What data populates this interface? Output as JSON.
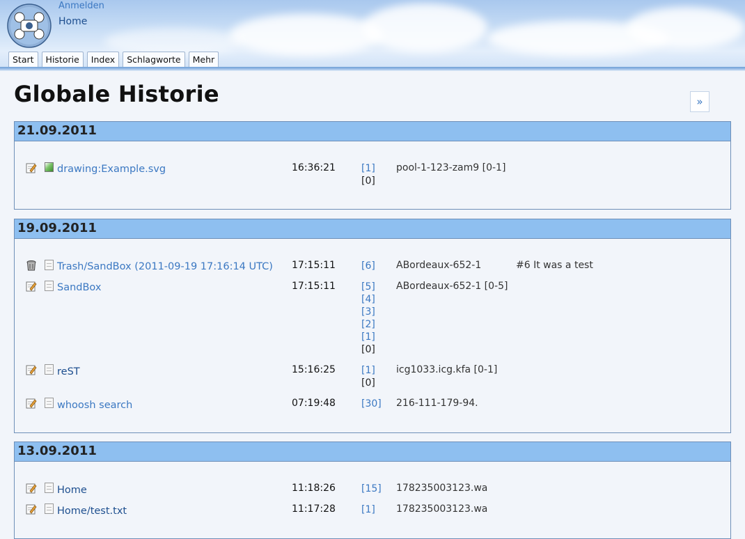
{
  "header": {
    "login_label": "Anmelden",
    "home_label": "Home",
    "tabs": [
      {
        "label": "Start"
      },
      {
        "label": "Historie"
      },
      {
        "label": "Index"
      },
      {
        "label": "Schlagworte"
      },
      {
        "label": "Mehr"
      }
    ]
  },
  "page": {
    "title": "Globale Historie",
    "next_label": "»"
  },
  "days": [
    {
      "date": "21.09.2011",
      "entries": [
        {
          "action_icon": "edit-icon",
          "type_icon": "image-file-icon",
          "name": "drawing:Example.svg",
          "time": "16:36:21",
          "rev_links": [
            "[1]"
          ],
          "rev_current": "[0]",
          "editor": "pool-1-123-zam9 [0-1]",
          "comment": ""
        }
      ]
    },
    {
      "date": "19.09.2011",
      "entries": [
        {
          "action_icon": "trash-icon",
          "type_icon": "page-icon",
          "name": "Trash/SandBox (2011-09-19 17:16:14 UTC)",
          "time": "17:15:11",
          "rev_links": [
            "[6]"
          ],
          "rev_current": "",
          "editor": "ABordeaux-652-1",
          "comment": "#6 It was a test"
        },
        {
          "action_icon": "edit-icon",
          "type_icon": "page-icon",
          "name": "SandBox",
          "time": "17:15:11",
          "rev_links": [
            "[5]",
            "[4]",
            "[3]",
            "[2]",
            "[1]"
          ],
          "rev_current": "[0]",
          "editor": "ABordeaux-652-1 [0-5]",
          "comment": ""
        },
        {
          "action_icon": "edit-icon",
          "type_icon": "page-icon",
          "name": "reST",
          "time": "15:16:25",
          "rev_links": [
            "[1]"
          ],
          "rev_current": "[0]",
          "editor": "icg1033.icg.kfa [0-1]",
          "comment": ""
        },
        {
          "action_icon": "edit-icon",
          "type_icon": "page-icon",
          "name": "whoosh search",
          "time": "07:19:48",
          "rev_links": [
            "[30]"
          ],
          "rev_current": "",
          "editor": "216-111-179-94.",
          "comment": ""
        }
      ]
    },
    {
      "date": "13.09.2011",
      "entries": [
        {
          "action_icon": "edit-icon",
          "type_icon": "page-icon",
          "name": "Home",
          "time": "11:18:26",
          "rev_links": [
            "[15]"
          ],
          "rev_current": "",
          "editor": "178235003123.wa",
          "comment": ""
        },
        {
          "action_icon": "edit-icon",
          "type_icon": "page-icon",
          "name": "Home/test.txt",
          "time": "11:17:28",
          "rev_links": [
            "[1]"
          ],
          "rev_current": "",
          "editor": "178235003123.wa",
          "comment": ""
        }
      ]
    }
  ],
  "colors": {
    "link": "#3b78c2",
    "day_header": "#8ebff0",
    "border": "#6e8fb8"
  }
}
